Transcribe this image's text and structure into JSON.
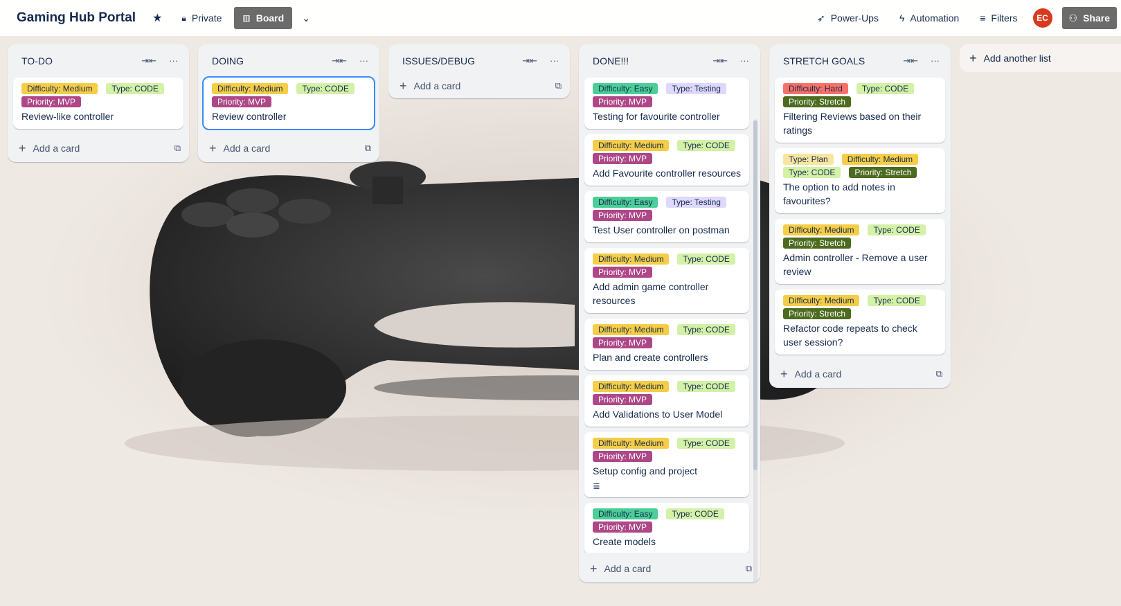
{
  "header": {
    "title": "Gaming Hub Portal",
    "visibility": "Private",
    "view": "Board",
    "actions": [
      "Power-Ups",
      "Automation",
      "Filters"
    ],
    "avatar_initials": "EC",
    "share": "Share"
  },
  "lists": [
    {
      "title": "TO-DO",
      "cards": [
        {
          "labels": [
            {
              "text": "Difficulty: Medium",
              "kind": "medium"
            },
            {
              "text": "Type: CODE",
              "kind": "code"
            },
            {
              "text": "Priority: MVP",
              "kind": "mvp"
            }
          ],
          "title": "Review-like controller"
        }
      ],
      "add_card": "Add a card"
    },
    {
      "title": "DOING",
      "cards": [
        {
          "labels": [
            {
              "text": "Difficulty: Medium",
              "kind": "medium"
            },
            {
              "text": "Type: CODE",
              "kind": "code"
            },
            {
              "text": "Priority: MVP",
              "kind": "mvp"
            }
          ],
          "title": "Review controller",
          "selected": true
        }
      ],
      "add_card": "Add a card"
    },
    {
      "title": "ISSUES/DEBUG",
      "cards": [],
      "add_card": "Add a card"
    },
    {
      "title": "DONE!!!",
      "cards": [
        {
          "labels": [
            {
              "text": "Difficulty: Easy",
              "kind": "easy"
            },
            {
              "text": "Type: Testing",
              "kind": "testing"
            },
            {
              "text": "Priority: MVP",
              "kind": "mvp"
            }
          ],
          "title": "Testing for favourite controller"
        },
        {
          "labels": [
            {
              "text": "Difficulty: Medium",
              "kind": "medium"
            },
            {
              "text": "Type: CODE",
              "kind": "code"
            },
            {
              "text": "Priority: MVP",
              "kind": "mvp"
            }
          ],
          "title": "Add Favourite controller resources"
        },
        {
          "labels": [
            {
              "text": "Difficulty: Easy",
              "kind": "easy"
            },
            {
              "text": "Type: Testing",
              "kind": "testing"
            },
            {
              "text": "Priority: MVP",
              "kind": "mvp"
            }
          ],
          "title": "Test User controller on postman"
        },
        {
          "labels": [
            {
              "text": "Difficulty: Medium",
              "kind": "medium"
            },
            {
              "text": "Type: CODE",
              "kind": "code"
            },
            {
              "text": "Priority: MVP",
              "kind": "mvp"
            }
          ],
          "title": "Add admin game controller resources"
        },
        {
          "labels": [
            {
              "text": "Difficulty: Medium",
              "kind": "medium"
            },
            {
              "text": "Type: CODE",
              "kind": "code"
            },
            {
              "text": "Priority: MVP",
              "kind": "mvp"
            }
          ],
          "title": "Plan and create controllers"
        },
        {
          "labels": [
            {
              "text": "Difficulty: Medium",
              "kind": "medium"
            },
            {
              "text": "Type: CODE",
              "kind": "code"
            },
            {
              "text": "Priority: MVP",
              "kind": "mvp"
            }
          ],
          "title": "Add Validations to User Model"
        },
        {
          "labels": [
            {
              "text": "Difficulty: Medium",
              "kind": "medium"
            },
            {
              "text": "Type: CODE",
              "kind": "code"
            },
            {
              "text": "Priority: MVP",
              "kind": "mvp"
            }
          ],
          "title": "Setup config and project",
          "has_description": true
        },
        {
          "labels": [
            {
              "text": "Difficulty: Easy",
              "kind": "easy"
            },
            {
              "text": "Type: CODE",
              "kind": "code"
            },
            {
              "text": "Priority: MVP",
              "kind": "mvp"
            }
          ],
          "title": "Create models"
        }
      ],
      "add_card": "Add a card"
    },
    {
      "title": "STRETCH GOALS",
      "cards": [
        {
          "labels": [
            {
              "text": "Difficulty: Hard",
              "kind": "hard"
            },
            {
              "text": "Type: CODE",
              "kind": "code"
            },
            {
              "text": "Priority: Stretch",
              "kind": "stretch"
            }
          ],
          "title": "Filtering Reviews based on their ratings"
        },
        {
          "labels": [
            {
              "text": "Type: Plan",
              "kind": "plan"
            },
            {
              "text": "Difficulty: Medium",
              "kind": "medium"
            },
            {
              "text": "Type: CODE",
              "kind": "code"
            },
            {
              "text": "Priority: Stretch",
              "kind": "stretch"
            }
          ],
          "title": "The option to add notes in favourites?"
        },
        {
          "labels": [
            {
              "text": "Difficulty: Medium",
              "kind": "medium"
            },
            {
              "text": "Type: CODE",
              "kind": "code"
            },
            {
              "text": "Priority: Stretch",
              "kind": "stretch"
            }
          ],
          "title": "Admin controller - Remove a user review"
        },
        {
          "labels": [
            {
              "text": "Difficulty: Medium",
              "kind": "medium"
            },
            {
              "text": "Type: CODE",
              "kind": "code"
            },
            {
              "text": "Priority: Stretch",
              "kind": "stretch"
            }
          ],
          "title": "Refactor code repeats to check user session?"
        }
      ],
      "add_card": "Add a card"
    }
  ],
  "add_list": "Add another list"
}
